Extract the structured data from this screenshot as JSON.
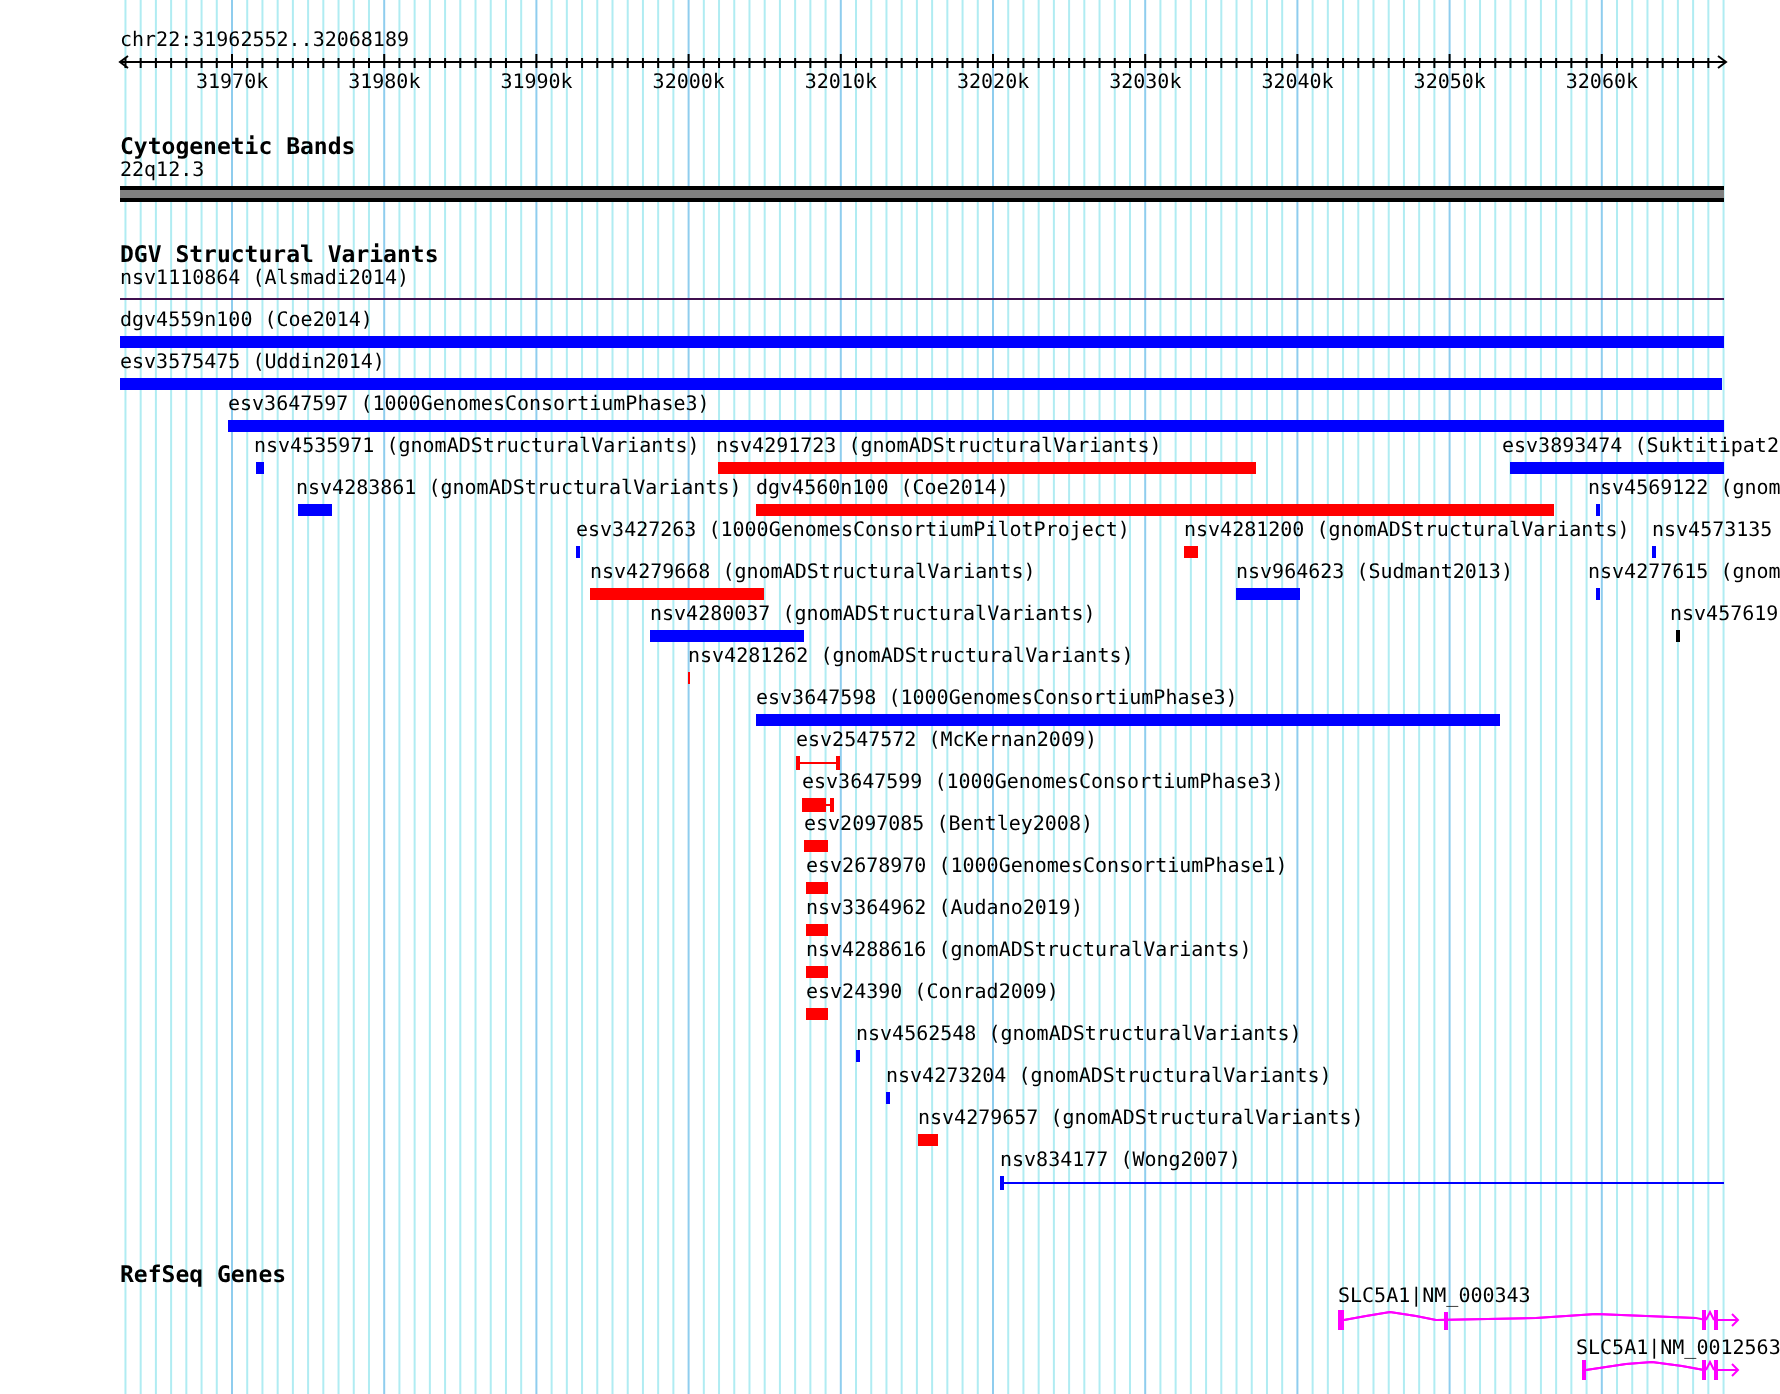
{
  "ruler": {
    "location": "chr22:31962552..32068189",
    "ticks": [
      "31970k",
      "31980k",
      "31990k",
      "32000k",
      "32010k",
      "32020k",
      "32030k",
      "32040k",
      "32050k",
      "32060k"
    ]
  },
  "tracks": [
    {
      "title": "Cytogenetic Bands",
      "kind": "bands",
      "features": [
        {
          "label": "22q12.3"
        }
      ]
    },
    {
      "title": "DGV Structural Variants",
      "kind": "variants",
      "features": [
        {
          "label": "nsv1110864 (Alsmadi2014)",
          "color": "#3f0f4f",
          "kind": "line"
        },
        {
          "label": "dgv4559n100 (Coe2014)",
          "color": "#0000ff",
          "kind": "bar"
        },
        {
          "label": "esv3575475 (Uddin2014)",
          "color": "#0000ff",
          "kind": "bar"
        },
        {
          "label": "esv3647597 (1000GenomesConsortiumPhase3)",
          "color": "#0000ff",
          "kind": "bar"
        },
        {
          "label": "nsv4535971 (gnomADStructuralVariants)",
          "color": "#0000ff",
          "kind": "bar"
        },
        {
          "label": "nsv4291723 (gnomADStructuralVariants)",
          "color": "#ff0000",
          "kind": "bar"
        },
        {
          "label": "esv3893474 (Suktitipat2",
          "color": "#0000ff",
          "kind": "bar"
        },
        {
          "label": "nsv4283861 (gnomADStructuralVariants)",
          "color": "#0000ff",
          "kind": "bar"
        },
        {
          "label": "dgv4560n100 (Coe2014)",
          "color": "#ff0000",
          "kind": "bar"
        },
        {
          "label": "nsv4569122 (gnom",
          "color": "#0000ff",
          "kind": "bar"
        },
        {
          "label": "esv3427263 (1000GenomesConsortiumPilotProject)",
          "color": "#0000ff",
          "kind": "bar"
        },
        {
          "label": "nsv4281200 (gnomADStructuralVariants)",
          "color": "#ff0000",
          "kind": "bar"
        },
        {
          "label": "nsv4573135",
          "color": "#0000ff",
          "kind": "bar"
        },
        {
          "label": "nsv4279668 (gnomADStructuralVariants)",
          "color": "#ff0000",
          "kind": "bar"
        },
        {
          "label": "nsv964623 (Sudmant2013)",
          "color": "#0000ff",
          "kind": "bar"
        },
        {
          "label": "nsv4277615 (gnom",
          "color": "#0000ff",
          "kind": "bar"
        },
        {
          "label": "nsv4280037 (gnomADStructuralVariants)",
          "color": "#0000ff",
          "kind": "bar"
        },
        {
          "label": "nsv457619",
          "color": "#000000",
          "kind": "bar"
        },
        {
          "label": "nsv4281262 (gnomADStructuralVariants)",
          "color": "#ff0000",
          "kind": "bar"
        },
        {
          "label": "esv3647598 (1000GenomesConsortiumPhase3)",
          "color": "#0000ff",
          "kind": "bar"
        },
        {
          "label": "esv2547572 (McKernan2009)",
          "color": "#ff0000",
          "kind": "span"
        },
        {
          "label": "esv3647599 (1000GenomesConsortiumPhase3)",
          "color": "#ff0000",
          "kind": "bar-span"
        },
        {
          "label": "esv2097085 (Bentley2008)",
          "color": "#ff0000",
          "kind": "bar"
        },
        {
          "label": "esv2678970 (1000GenomesConsortiumPhase1)",
          "color": "#ff0000",
          "kind": "bar"
        },
        {
          "label": "nsv3364962 (Audano2019)",
          "color": "#ff0000",
          "kind": "bar"
        },
        {
          "label": "nsv4288616 (gnomADStructuralVariants)",
          "color": "#ff0000",
          "kind": "bar"
        },
        {
          "label": "esv24390 (Conrad2009)",
          "color": "#ff0000",
          "kind": "bar"
        },
        {
          "label": "nsv4562548 (gnomADStructuralVariants)",
          "color": "#0000ff",
          "kind": "bar"
        },
        {
          "label": "nsv4273204 (gnomADStructuralVariants)",
          "color": "#0000ff",
          "kind": "bar"
        },
        {
          "label": "nsv4279657 (gnomADStructuralVariants)",
          "color": "#ff0000",
          "kind": "bar"
        },
        {
          "label": "nsv834177 (Wong2007)",
          "color": "#0000ff",
          "kind": "span"
        }
      ]
    },
    {
      "title": "RefSeq Genes",
      "kind": "genes",
      "features": [
        {
          "label": "SLC5A1|NM_000343"
        },
        {
          "label": "SLC5A1|NM_0012563"
        }
      ]
    }
  ]
}
